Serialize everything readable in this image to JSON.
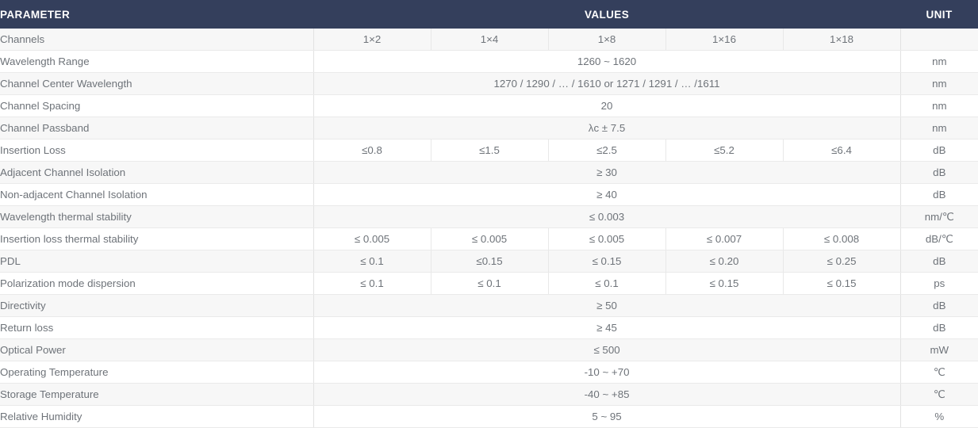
{
  "header": {
    "parameter": "PARAMETER",
    "values": "VALUES",
    "unit": "UNIT",
    "bg_color": "#343f5c",
    "text_color": "#ffffff"
  },
  "colors": {
    "header_bg": "#343f5c",
    "row_odd_bg": "#f7f7f7",
    "row_even_bg": "#ffffff",
    "body_text": "#6e7379",
    "border": "#eaeaea"
  },
  "channel_columns": [
    "1×2",
    "1×4",
    "1×8",
    "1×16",
    "1×18"
  ],
  "rows": [
    {
      "parameter": "Channels",
      "span": false,
      "values": [
        "1×2",
        "1×4",
        "1×8",
        "1×16",
        "1×18"
      ],
      "unit": ""
    },
    {
      "parameter": "Wavelength Range",
      "span": true,
      "value": "1260 ~ 1620",
      "unit": "nm"
    },
    {
      "parameter": "Channel Center Wavelength",
      "span": true,
      "value": "1270 / 1290 / … / 1610 or 1271 / 1291 / … /1611",
      "unit": "nm"
    },
    {
      "parameter": "Channel Spacing",
      "span": true,
      "value": "20",
      "unit": "nm"
    },
    {
      "parameter": "Channel Passband",
      "span": true,
      "value": "λc ± 7.5",
      "unit": "nm"
    },
    {
      "parameter": "Insertion Loss",
      "span": false,
      "values": [
        "≤0.8",
        "≤1.5",
        "≤2.5",
        "≤5.2",
        "≤6.4"
      ],
      "unit": "dB"
    },
    {
      "parameter": "Adjacent Channel Isolation",
      "span": true,
      "value": "≥ 30",
      "unit": "dB"
    },
    {
      "parameter": "Non-adjacent Channel Isolation",
      "span": true,
      "value": "≥ 40",
      "unit": "dB"
    },
    {
      "parameter": "Wavelength thermal stability",
      "span": true,
      "value": "≤ 0.003",
      "unit": "nm/℃"
    },
    {
      "parameter": "Insertion loss thermal stability",
      "span": false,
      "values": [
        "≤ 0.005",
        "≤ 0.005",
        "≤ 0.005",
        "≤ 0.007",
        "≤ 0.008"
      ],
      "unit": "dB/℃"
    },
    {
      "parameter": "PDL",
      "span": false,
      "values": [
        "≤ 0.1",
        "≤0.15",
        "≤ 0.15",
        "≤ 0.20",
        "≤ 0.25"
      ],
      "unit": "dB"
    },
    {
      "parameter": "Polarization mode dispersion",
      "span": false,
      "values": [
        "≤ 0.1",
        "≤ 0.1",
        "≤ 0.1",
        "≤ 0.15",
        "≤ 0.15"
      ],
      "unit": "ps"
    },
    {
      "parameter": "Directivity",
      "span": true,
      "value": "≥ 50",
      "unit": "dB"
    },
    {
      "parameter": "Return loss",
      "span": true,
      "value": "≥ 45",
      "unit": "dB"
    },
    {
      "parameter": "Optical Power",
      "span": true,
      "value": "≤ 500",
      "unit": "mW"
    },
    {
      "parameter": "Operating Temperature",
      "span": true,
      "value": "-10 ~ +70",
      "unit": "℃"
    },
    {
      "parameter": "Storage Temperature",
      "span": true,
      "value": "-40 ~ +85",
      "unit": "℃"
    },
    {
      "parameter": "Relative Humidity",
      "span": true,
      "value": "5 ~ 95",
      "unit": "%"
    }
  ]
}
